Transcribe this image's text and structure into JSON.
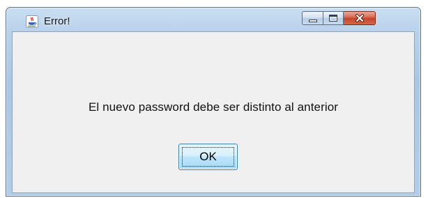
{
  "window": {
    "title": "Error!",
    "icon": "java-coffee-cup-icon",
    "controls": {
      "minimize_icon": "minimize-icon",
      "maximize_icon": "maximize-icon",
      "close_icon": "close-icon"
    }
  },
  "dialog": {
    "message": "El nuevo password debe ser distinto al anterior",
    "ok_label": "OK"
  },
  "colors": {
    "close_button": "#d7664e",
    "ok_button": "#bee6fd",
    "client_background": "#f0f0f0"
  }
}
